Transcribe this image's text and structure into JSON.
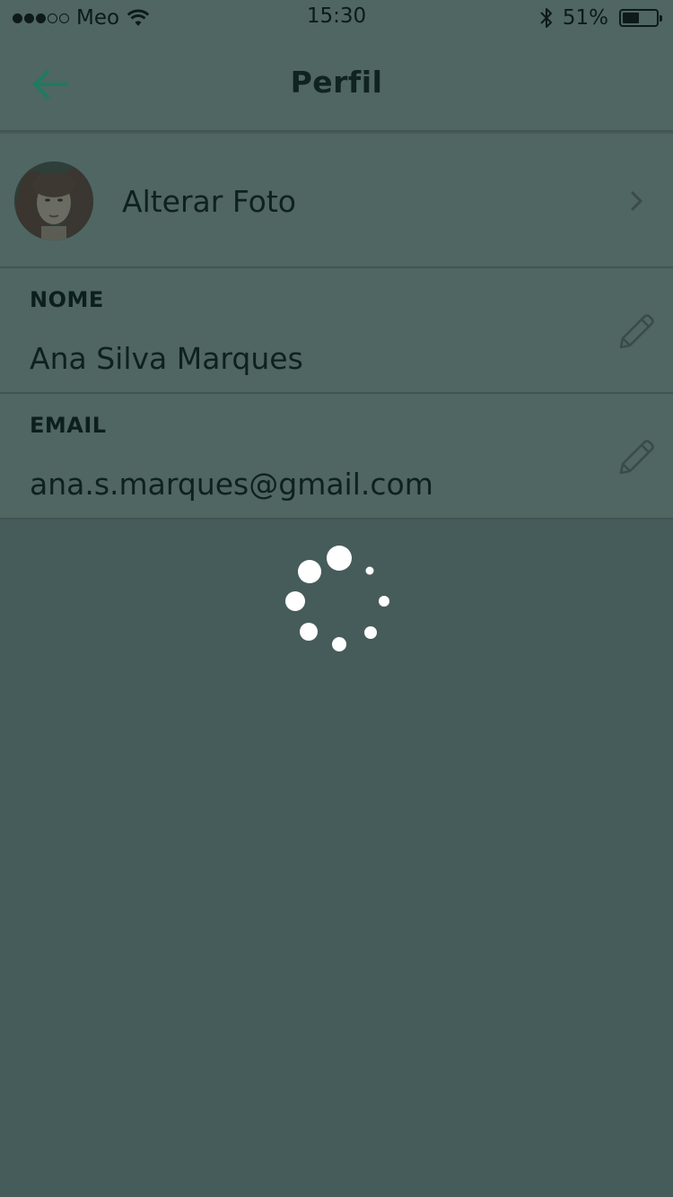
{
  "status_bar": {
    "carrier": "Meo",
    "time": "15:30",
    "battery_percent": "51%",
    "battery_level": 0.51,
    "signal_bars_filled": 3,
    "signal_bars_total": 5,
    "icons": [
      "wifi-icon",
      "bluetooth-icon",
      "battery-icon"
    ]
  },
  "nav": {
    "title": "Perfil",
    "back_icon": "arrow-left-icon"
  },
  "photo_row": {
    "label": "Alterar Foto",
    "chevron_icon": "chevron-right-icon"
  },
  "fields": {
    "name": {
      "label": "NOME",
      "value": "Ana Silva Marques",
      "icon": "pencil-icon"
    },
    "email": {
      "label": "EMAIL",
      "value": "ana.s.marques@gmail.com",
      "icon": "pencil-icon"
    }
  },
  "loading": {
    "icon": "spinner-icon"
  },
  "colors": {
    "overlay_background": "#465c5a",
    "row_background": "#4f6663",
    "accent": "#1f7a5f",
    "text_dark": "#0f211e",
    "spinner": "#ffffff"
  }
}
